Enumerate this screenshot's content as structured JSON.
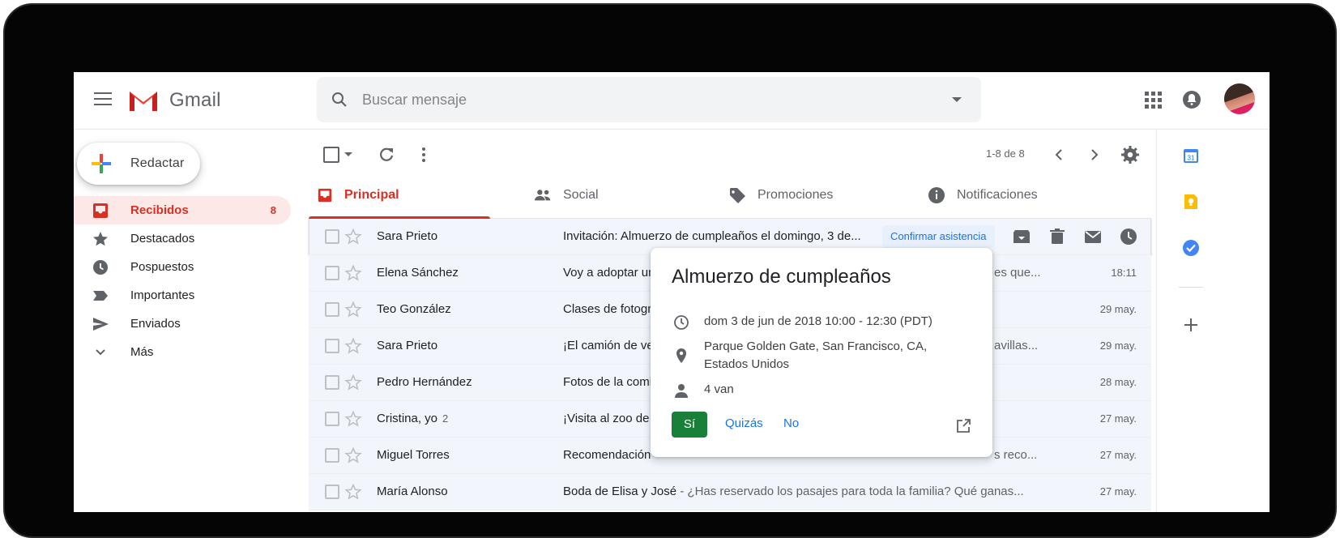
{
  "app": {
    "name": "Gmail"
  },
  "search": {
    "placeholder": "Buscar mensaje"
  },
  "compose": {
    "label": "Redactar"
  },
  "nav": [
    {
      "label": "Recibidos",
      "count": "8",
      "icon": "inbox-icon",
      "active": true
    },
    {
      "label": "Destacados",
      "icon": "star-icon"
    },
    {
      "label": "Pospuestos",
      "icon": "clock-icon"
    },
    {
      "label": "Importantes",
      "icon": "important-icon"
    },
    {
      "label": "Enviados",
      "icon": "send-icon"
    },
    {
      "label": "Más",
      "icon": "chevron-down-icon"
    }
  ],
  "toolbar": {
    "pager": "1-8 de 8"
  },
  "tabs": [
    {
      "label": "Principal",
      "icon": "inbox-icon",
      "active": true
    },
    {
      "label": "Social",
      "icon": "people-icon"
    },
    {
      "label": "Promociones",
      "icon": "tag-icon"
    },
    {
      "label": "Notificaciones",
      "icon": "info-icon"
    }
  ],
  "emails": [
    {
      "sender": "Sara Prieto",
      "count": "",
      "subject": "Invitación: Almuerzo de cumpleaños el domingo, 3 de...",
      "snippet": "",
      "date": ""
    },
    {
      "sender": "Elena Sánchez",
      "count": "",
      "subject": "Voy a adoptar un",
      "snippet": "es que...",
      "date": "18:11"
    },
    {
      "sender": "Teo González",
      "count": "",
      "subject": "Clases de fotogra",
      "snippet": "",
      "date": "29 may."
    },
    {
      "sender": "Sara Prieto",
      "count": "",
      "subject": "¡El camión de ver",
      "snippet": "avillas...",
      "date": "29 may."
    },
    {
      "sender": "Pedro Hernández",
      "count": "",
      "subject": "Fotos de la comi",
      "snippet": "",
      "date": "28 may."
    },
    {
      "sender": "Cristina, yo",
      "count": "2",
      "subject": "¡Visita al zoo de S",
      "snippet": "",
      "date": "27 may."
    },
    {
      "sender": "Miguel Torres",
      "count": "",
      "subject": "Recomendación",
      "snippet": "s reco...",
      "date": "27 may."
    },
    {
      "sender": "María Alonso",
      "count": "",
      "subject": "Boda de Elisa y José",
      "snippet": " - ¿Has reservado los pasajes para toda la familia? Qué ganas...",
      "date": "27 may."
    }
  ],
  "rsvp_chip": "Confirmar asistencia",
  "event": {
    "title": "Almuerzo de cumpleaños",
    "when": "dom 3 de jun de 2018 10:00 - 12:30 (PDT)",
    "where_line1": "Parque Golden Gate, San Francisco, CA,",
    "where_line2": "Estados Unidos",
    "guests": "4 van",
    "yes": "Sí",
    "maybe": "Quizás",
    "no": "No"
  },
  "side_panel": {
    "calendar_day": "31"
  },
  "colors": {
    "accent_red": "#d93025",
    "blue": "#1a73e8",
    "green": "#188038"
  }
}
